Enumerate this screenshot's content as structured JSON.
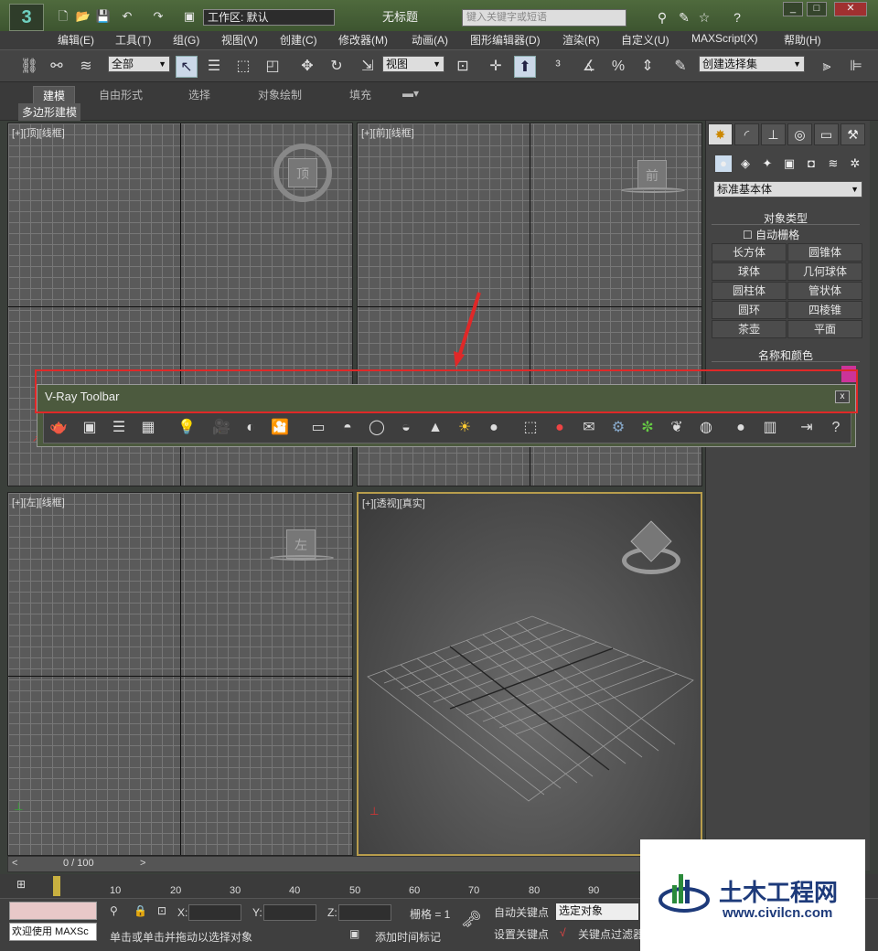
{
  "titlebar": {
    "workspace": "工作区: 默认",
    "title": "无标题",
    "search_placeholder": "键入关键字或短语"
  },
  "menu": [
    "编辑(E)",
    "工具(T)",
    "组(G)",
    "视图(V)",
    "创建(C)",
    "修改器(M)",
    "动画(A)",
    "图形编辑器(D)",
    "渲染(R)",
    "自定义(U)",
    "MAXScript(X)",
    "帮助(H)"
  ],
  "toolbar": {
    "selection_filter": "全部",
    "ref_coord": "视图",
    "named_selection": "创建选择集"
  },
  "ribbon": {
    "tabs": [
      "建模",
      "自由形式",
      "选择",
      "对象绘制",
      "填充"
    ],
    "sub_label": "多边形建模"
  },
  "viewports": {
    "top": "[+][顶][线框]",
    "front": "[+][前][线框]",
    "left": "[+][左][线框]",
    "persp": "[+][透视][真实]",
    "cube_top": "顶",
    "cube_front": "前",
    "cube_left": "左"
  },
  "command_panel": {
    "category": "标准基本体",
    "rollout_object_type": "对象类型",
    "autogrid": "自动栅格",
    "buttons": [
      "长方体",
      "圆锥体",
      "球体",
      "几何球体",
      "圆柱体",
      "管状体",
      "圆环",
      "四棱锥",
      "茶壶",
      "平面"
    ],
    "rollout_name_color": "名称和颜色",
    "name_color": "#cc3399"
  },
  "vray_toolbar": {
    "title": "V-Ray Toolbar",
    "close": "x"
  },
  "timeline": {
    "frame": "0 / 100",
    "ticks": [
      "10",
      "20",
      "30",
      "40",
      "50",
      "60",
      "70",
      "80",
      "90"
    ]
  },
  "status": {
    "maxscript": "欢迎使用 MAXSc",
    "prompt": "单击或单击并拖动以选择对象",
    "x_label": "X:",
    "y_label": "Y:",
    "z_label": "Z:",
    "grid": "栅格 = 1",
    "auto_key": "自动关键点",
    "set_key": "设置关键点",
    "selected": "选定对象",
    "add_time_tag": "添加时间标记",
    "key_filters": "关键点过滤器"
  },
  "watermark": {
    "title": "土木工程网",
    "url": "www.civilcn.com"
  }
}
